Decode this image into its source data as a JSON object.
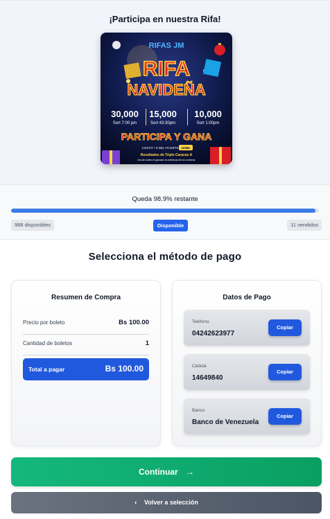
{
  "hero": {
    "title": "¡Participa en nuestra Rifa!",
    "poster": {
      "brand": "RIFAS JM",
      "headline_1": "RIFA",
      "headline_2": "NAVIDEÑA",
      "prizes": [
        {
          "amount": "30,000",
          "time": "Sort 7:00 pm"
        },
        {
          "amount": "15,000",
          "time": "Sort 43:30pm"
        },
        {
          "amount": "10,000",
          "time": "Sort 1:00pm"
        }
      ],
      "cta": "PARTICIPA Y GANA",
      "cost_line": "COSTO * 0 DEL TICKETS A",
      "cost_badge": "100Bs",
      "results_line": "Resultados de Triple Caracas A",
      "fine_print": "Día de sorteo el ganador la evidencia de los numeros"
    }
  },
  "progress": {
    "remaining_text": "Queda 98.9% restante",
    "fill_percent": 98.9,
    "available": "988 disponibles",
    "status": "Disponible",
    "sold": "11 vendidos"
  },
  "section_title": "Selecciona el método de pago",
  "summary": {
    "title": "Resumen de Compra",
    "price_label": "Precio por boleto",
    "price_value": "Bs 100.00",
    "qty_label": "Cantidad de boletos",
    "qty_value": "1",
    "total_label": "Total a pagar",
    "total_value": "Bs 100.00"
  },
  "payment": {
    "title": "Datos de Pago",
    "fields": [
      {
        "label": "Teléfono",
        "value": "04242623977",
        "button": "Copiar"
      },
      {
        "label": "Cédula",
        "value": "14649840",
        "button": "Copiar"
      },
      {
        "label": "Banco",
        "value": "Banco de Venezuela",
        "button": "Copiar"
      }
    ]
  },
  "actions": {
    "continue_label": "Continuar",
    "continue_icon": "→",
    "back_label": "Volver a selección",
    "back_icon": "‹"
  },
  "colors": {
    "primary": "#2159de",
    "success": "#10b981",
    "neutral": "#6b7280"
  }
}
